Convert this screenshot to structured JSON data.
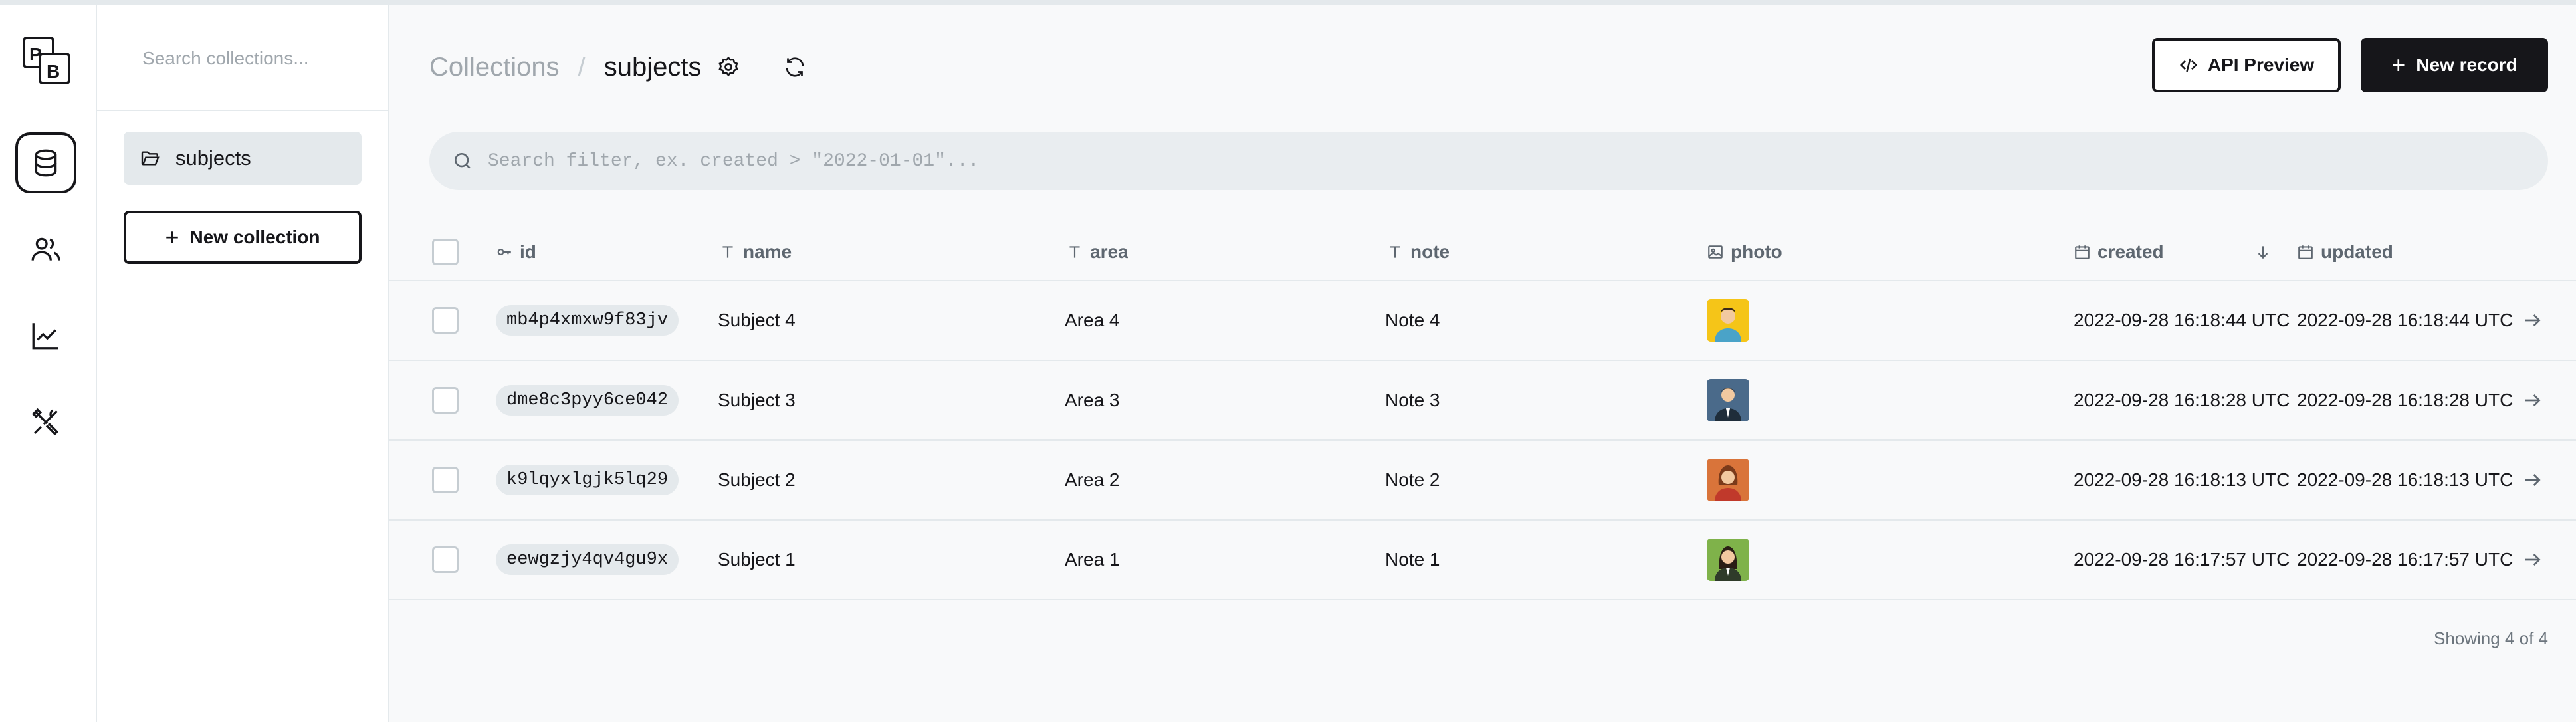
{
  "app": {
    "logo": "PB",
    "logo_top": "P",
    "logo_bottom": "B"
  },
  "rail": {
    "items": [
      {
        "icon": "database-icon",
        "active": true
      },
      {
        "icon": "users-icon",
        "active": false
      },
      {
        "icon": "chart-icon",
        "active": false
      },
      {
        "icon": "tools-icon",
        "active": false
      }
    ]
  },
  "sidebar": {
    "search_placeholder": "Search collections...",
    "collections": [
      {
        "label": "subjects",
        "icon": "folder-open-icon"
      }
    ],
    "new_collection_label": "New collection"
  },
  "header": {
    "breadcrumb_root": "Collections",
    "breadcrumb_separator": "/",
    "breadcrumb_current": "subjects",
    "api_preview_label": "API Preview",
    "new_record_label": "New record"
  },
  "filter": {
    "placeholder": "Search filter, ex. created > \"2022-01-01\"..."
  },
  "table": {
    "columns": [
      {
        "key": "id",
        "label": "id",
        "icon": "key-icon"
      },
      {
        "key": "name",
        "label": "name",
        "icon": "text-icon"
      },
      {
        "key": "area",
        "label": "area",
        "icon": "text-icon"
      },
      {
        "key": "note",
        "label": "note",
        "icon": "text-icon"
      },
      {
        "key": "photo",
        "label": "photo",
        "icon": "image-icon"
      },
      {
        "key": "created",
        "label": "created",
        "icon": "calendar-icon",
        "sort": "desc"
      },
      {
        "key": "updated",
        "label": "updated",
        "icon": "calendar-icon"
      }
    ],
    "rows": [
      {
        "id": "mb4p4xmxw9f83jv",
        "name": "Subject 4",
        "area": "Area 4",
        "note": "Note 4",
        "photo_bg": "#f5c518",
        "photo_shirt": "#4aa3c8",
        "created": "2022-09-28 16:18:44 UTC",
        "updated": "2022-09-28 16:18:44 UTC"
      },
      {
        "id": "dme8c3pyy6ce042",
        "name": "Subject 3",
        "area": "Area 3",
        "note": "Note 3",
        "photo_bg": "#4a6a8a",
        "photo_shirt": "#1f2d3a",
        "created": "2022-09-28 16:18:28 UTC",
        "updated": "2022-09-28 16:18:28 UTC"
      },
      {
        "id": "k9lqyxlgjk5lq29",
        "name": "Subject 2",
        "area": "Area 2",
        "note": "Note 2",
        "photo_bg": "#d9743a",
        "photo_shirt": "#c0392b",
        "created": "2022-09-28 16:18:13 UTC",
        "updated": "2022-09-28 16:18:13 UTC"
      },
      {
        "id": "eewgzjy4qv4gu9x",
        "name": "Subject 1",
        "area": "Area 1",
        "note": "Note 1",
        "photo_bg": "#7fb24a",
        "photo_shirt": "#2f3b2a",
        "created": "2022-09-28 16:17:57 UTC",
        "updated": "2022-09-28 16:17:57 UTC"
      }
    ]
  },
  "footer": {
    "showing": "Showing 4 of 4"
  },
  "colors": {
    "accent": "#16161a",
    "border": "#e4e9ec",
    "muted": "#a0a7ad",
    "background": "#f8f9fa"
  }
}
